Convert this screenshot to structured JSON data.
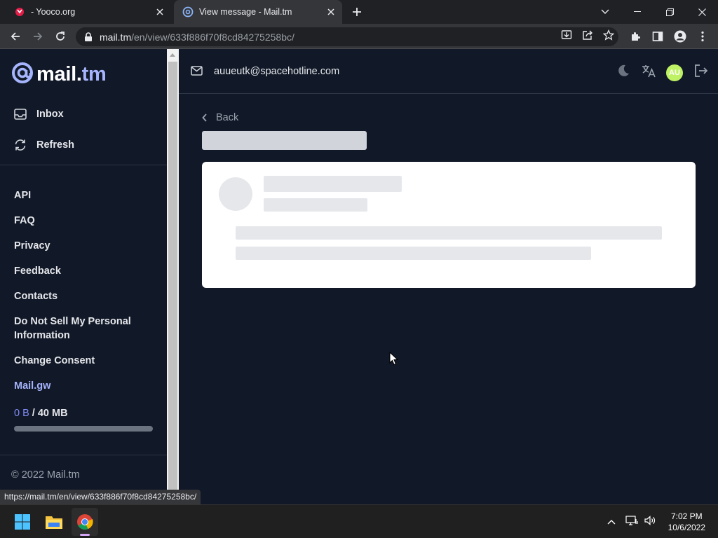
{
  "browser": {
    "tabs": [
      {
        "title": "- Yooco.org",
        "active": false
      },
      {
        "title": "View message - Mail.tm",
        "active": true
      }
    ],
    "url_host": "mail.tm",
    "url_path": "/en/view/633f886f70f8cd84275258bc/",
    "status_url": "https://mail.tm/en/view/633f886f70f8cd84275258bc/"
  },
  "sidebar": {
    "brand_prefix": "mail.",
    "brand_suffix": "tm",
    "nav": [
      {
        "label": "Inbox",
        "icon": "inbox-icon"
      },
      {
        "label": "Refresh",
        "icon": "refresh-icon"
      }
    ],
    "links": [
      "API",
      "FAQ",
      "Privacy",
      "Feedback",
      "Contacts",
      "Do Not Sell My Personal Information",
      "Change Consent",
      "Mail.gw"
    ],
    "quota_used": "0 B",
    "quota_total": "/ 40 MB",
    "quota_fraction": 0,
    "copyright": "© 2022 Mail.tm"
  },
  "header": {
    "email": "auueutk@spacehotline.com",
    "avatar_initials": "AU"
  },
  "message": {
    "back_label": "Back",
    "loading": true
  },
  "taskbar": {
    "time": "7:02 PM",
    "date": "10/6/2022"
  },
  "colors": {
    "background": "#111827",
    "accent": "#a5b4fc",
    "avatar": "#bef264"
  }
}
